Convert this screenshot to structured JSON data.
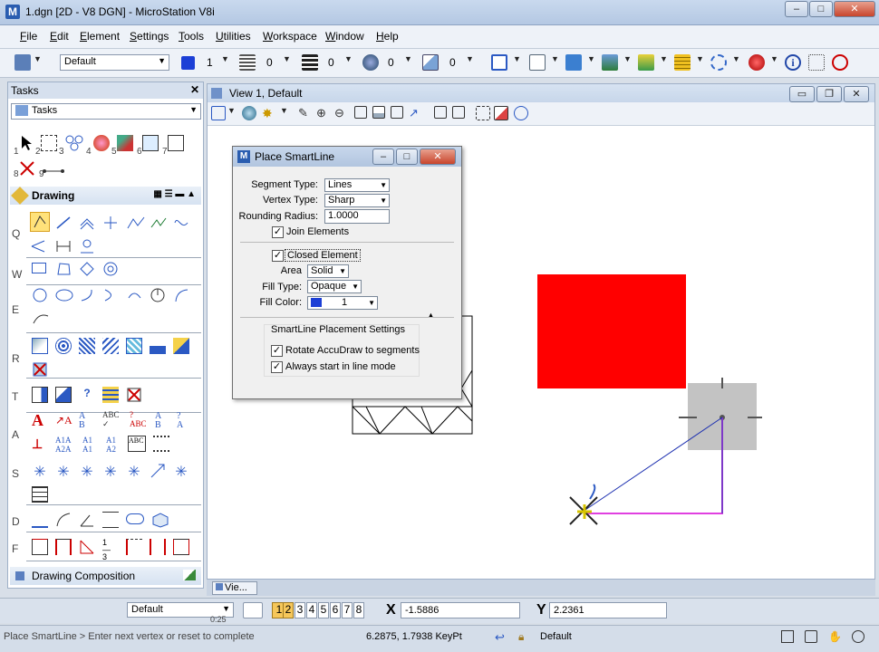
{
  "window": {
    "title": "1.dgn [2D - V8 DGN] - MicroStation V8i",
    "app_icon": "M"
  },
  "menu": [
    "File",
    "Edit",
    "Element",
    "Settings",
    "Tools",
    "Utilities",
    "Workspace",
    "Window",
    "Help"
  ],
  "menu_underlines": [
    "F",
    "E",
    "E",
    "S",
    "T",
    "U",
    "W",
    "W",
    "H"
  ],
  "toolbar": {
    "level_combo": "Default",
    "color_value": "1",
    "weight_value": "0",
    "style_value": "0",
    "transparency_value": "0",
    "priority_value": "0"
  },
  "tasks": {
    "header": "Tasks",
    "combo": "Tasks",
    "main_numbers": [
      "1",
      "2",
      "3",
      "4",
      "5",
      "6",
      "7",
      "8",
      "9"
    ],
    "section_title": "Drawing",
    "row_letters": [
      "Q",
      "W",
      "E",
      "R",
      "T",
      "A",
      "S",
      "D",
      "F"
    ],
    "footer": "Drawing Composition"
  },
  "view": {
    "title": "View 1, Default",
    "tab_label": "Vie..."
  },
  "dialog": {
    "title": "Place SmartLine",
    "segment_type_label": "Segment Type:",
    "segment_type_value": "Lines",
    "vertex_type_label": "Vertex Type:",
    "vertex_type_value": "Sharp",
    "rounding_radius_label": "Rounding Radius:",
    "rounding_radius_value": "1.0000",
    "join_elements_label": "Join Elements",
    "closed_element_label": "Closed Element",
    "area_label": "Area",
    "area_value": "Solid",
    "fill_type_label": "Fill Type:",
    "fill_type_value": "Opaque",
    "fill_color_label": "Fill Color:",
    "fill_color_value": "1",
    "placement_group": "SmartLine Placement Settings",
    "rotate_accudraw_label": "Rotate AccuDraw to segments",
    "always_start_label": "Always start in line mode"
  },
  "coords": {
    "x_label": "X",
    "x_value": "-1.5886",
    "y_label": "Y",
    "y_value": "2.2361",
    "level_combo": "Default",
    "view_numbers": [
      "1",
      "2",
      "3",
      "4",
      "5",
      "6",
      "7",
      "8"
    ]
  },
  "status": {
    "prompt": "Place SmartLine > Enter next vertex or reset to complete",
    "position": "6.2875, 1.7938 KeyPt",
    "active_level": "Default",
    "time_indicator": "0:25"
  },
  "colors": {
    "accent_blue": "#1c3fd6",
    "fill_red": "#ff0000",
    "line_magenta": "#e040e0",
    "accudraw_gray": "#bdbdbd"
  }
}
